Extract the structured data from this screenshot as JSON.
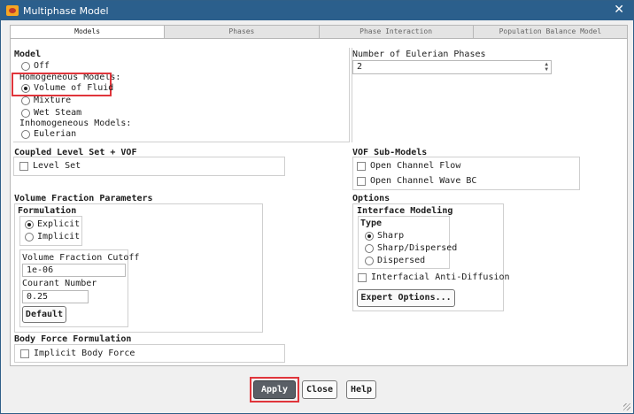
{
  "window": {
    "title": "Multiphase Model",
    "close_symbol": "✕"
  },
  "tabs": [
    {
      "label": "Models",
      "active": true
    },
    {
      "label": "Phases",
      "active": false
    },
    {
      "label": "Phase Interaction",
      "active": false
    },
    {
      "label": "Population Balance Model",
      "active": false
    }
  ],
  "model": {
    "heading": "Model",
    "off": "Off",
    "homogeneous_label": "Homogeneous Models:",
    "vof": "Volume of Fluid",
    "mixture": "Mixture",
    "wet_steam": "Wet Steam",
    "inhomogeneous_label": "Inhomogeneous Models:",
    "eulerian": "Eulerian",
    "selected": "Volume of Fluid"
  },
  "eulerian_phases": {
    "label": "Number of Eulerian Phases",
    "value": "2"
  },
  "coupled": {
    "heading": "Coupled Level Set + VOF",
    "level_set": "Level Set",
    "level_set_checked": false
  },
  "vof_sub_models": {
    "heading": "VOF Sub-Models",
    "open_channel_flow": "Open Channel Flow",
    "open_channel_wave_bc": "Open Channel Wave BC"
  },
  "vfp": {
    "heading": "Volume Fraction Parameters",
    "formulation_label": "Formulation",
    "explicit": "Explicit",
    "implicit": "Implicit",
    "selected": "Explicit",
    "cutoff_label": "Volume Fraction Cutoff",
    "cutoff_value": "1e-06",
    "courant_label": "Courant Number",
    "courant_value": "0.25",
    "default_button": "Default"
  },
  "options": {
    "heading": "Options",
    "interface_label": "Interface Modeling",
    "type_label": "Type",
    "sharp": "Sharp",
    "sharp_dispersed": "Sharp/Dispersed",
    "dispersed": "Dispersed",
    "selected": "Sharp",
    "anti_diffusion": "Interfacial Anti-Diffusion",
    "expert_button": "Expert Options..."
  },
  "body_force": {
    "heading": "Body Force Formulation",
    "implicit": "Implicit Body Force"
  },
  "footer": {
    "apply": "Apply",
    "close": "Close",
    "help": "Help"
  },
  "colors": {
    "titlebar": "#2b5f8c",
    "highlight": "#e0353b",
    "apply_bg": "#5a5f66"
  }
}
